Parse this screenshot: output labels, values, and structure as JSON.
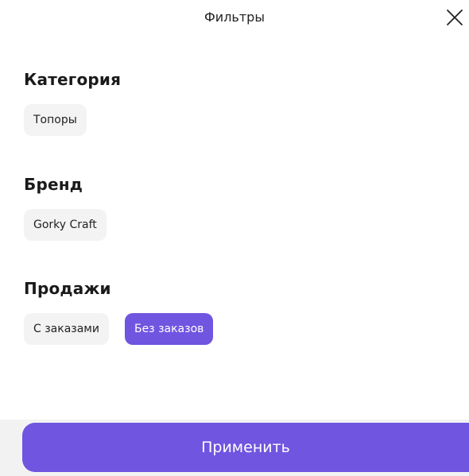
{
  "header": {
    "title": "Фильтры",
    "close_icon": "close-icon"
  },
  "sections": [
    {
      "title": "Категория",
      "options": [
        {
          "label": "Топоры",
          "selected": false
        }
      ]
    },
    {
      "title": "Бренд",
      "options": [
        {
          "label": "Gorky Craft",
          "selected": false
        }
      ]
    },
    {
      "title": "Продажи",
      "options": [
        {
          "label": "С заказами",
          "selected": false
        },
        {
          "label": "Без заказов",
          "selected": true
        }
      ]
    }
  ],
  "footer": {
    "apply_label": "Применить"
  },
  "colors": {
    "accent": "#6f55e0",
    "chip_bg": "#f3f3f4",
    "text": "#1a1a1a"
  }
}
